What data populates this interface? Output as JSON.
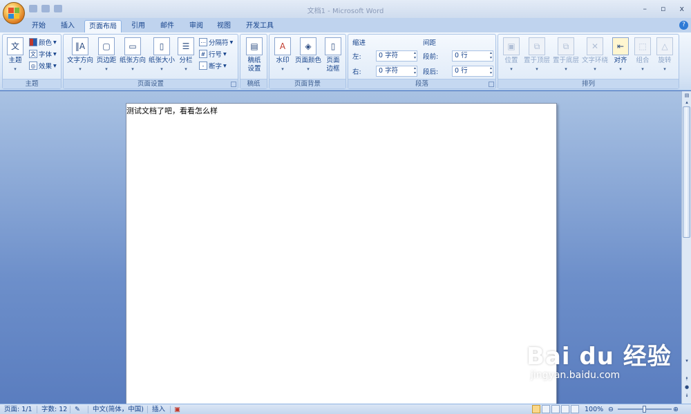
{
  "window": {
    "title": "文档1 - Microsoft Word",
    "minimize": "–",
    "restore": "▫",
    "close": "x"
  },
  "tabs": [
    {
      "label": "开始"
    },
    {
      "label": "插入"
    },
    {
      "label": "页面布局"
    },
    {
      "label": "引用"
    },
    {
      "label": "邮件"
    },
    {
      "label": "审阅"
    },
    {
      "label": "视图"
    },
    {
      "label": "开发工具"
    }
  ],
  "help_label": "?",
  "ribbon": {
    "theme": {
      "group": "主题",
      "themes": "主题",
      "colors": "颜色",
      "fonts": "字体",
      "effects": "效果"
    },
    "page_setup": {
      "group": "页面设置",
      "text_direction": "文字方向",
      "margins": "页边距",
      "orientation": "纸张方向",
      "size": "纸张大小",
      "columns": "分栏",
      "breaks": "分隔符",
      "line_numbers": "行号",
      "hyphenation": "断字"
    },
    "manuscript": {
      "group": "稿纸",
      "setup_line1": "稿纸",
      "setup_line2": "设置"
    },
    "page_background": {
      "group": "页面背景",
      "watermark": "水印",
      "page_color": "页面颜色",
      "borders_line1": "页面",
      "borders_line2": "边框"
    },
    "paragraph": {
      "group": "段落",
      "indent_title": "缩进",
      "spacing_title": "间距",
      "left_label": "左:",
      "right_label": "右:",
      "left_value": "0 字符",
      "right_value": "0 字符",
      "before_label": "段前:",
      "after_label": "段后:",
      "before_value": "0 行",
      "after_value": "0 行"
    },
    "arrange": {
      "group": "排列",
      "position": "位置",
      "bring_front": "置于顶层",
      "send_back": "置于底层",
      "text_wrap": "文字环绕",
      "align": "对齐",
      "group_btn": "组合",
      "rotate": "旋转"
    }
  },
  "document": {
    "text": "测试文档了吧，看看怎么样"
  },
  "statusbar": {
    "page": "页面: 1/1",
    "words": "字数: 12",
    "language": "中文(简体，中国)",
    "mode": "插入",
    "zoom": "100%"
  },
  "watermark": {
    "brand": "Bai du 经验",
    "url": "jingyan.baidu.com"
  }
}
